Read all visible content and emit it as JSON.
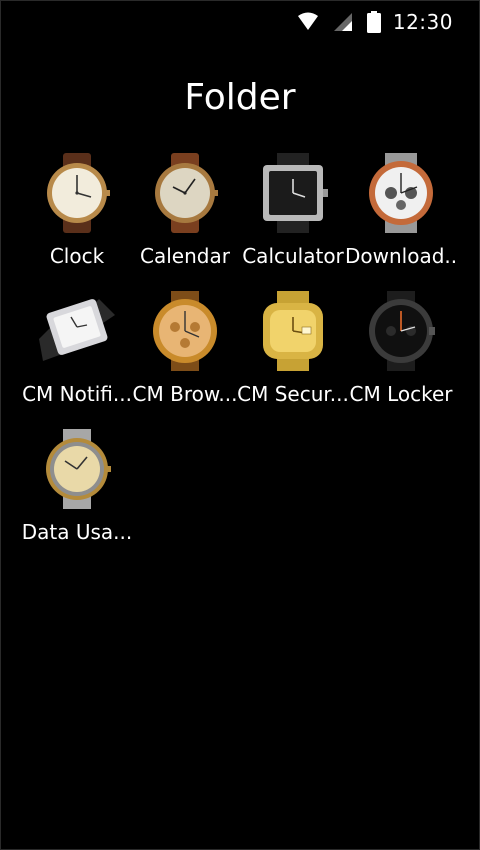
{
  "status_bar": {
    "time": "12:30",
    "icons": [
      "wifi-icon",
      "signal-icon",
      "battery-icon"
    ]
  },
  "folder": {
    "title": "Folder"
  },
  "apps": [
    {
      "label": "Clock",
      "icon": "gold-dress-watch-icon"
    },
    {
      "label": "Calendar",
      "icon": "vintage-gold-watch-icon"
    },
    {
      "label": "Calculator",
      "icon": "square-black-watch-icon"
    },
    {
      "label": "Download..",
      "icon": "chronograph-watch-icon"
    },
    {
      "label": "CM Notifi...",
      "icon": "rectangular-watch-icon"
    },
    {
      "label": "CM Brow...",
      "icon": "gold-chronograph-watch-icon"
    },
    {
      "label": "CM Secur...",
      "icon": "gold-bracelet-watch-icon"
    },
    {
      "label": "CM Locker",
      "icon": "black-sport-watch-icon"
    },
    {
      "label": "Data Usa...",
      "icon": "two-tone-watch-icon"
    }
  ],
  "colors": {
    "background": "#000000",
    "text": "#ffffff"
  }
}
